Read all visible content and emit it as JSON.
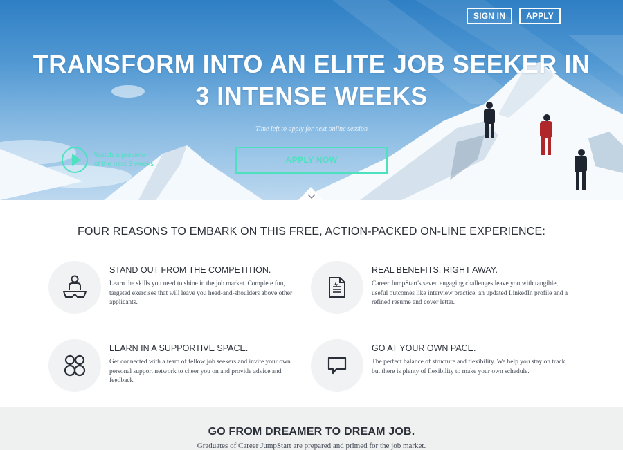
{
  "nav": {
    "sign_in": "SIGN IN",
    "apply": "APPLY"
  },
  "hero": {
    "headline_line1": "TRANSFORM INTO AN ELITE JOB SEEKER IN",
    "headline_line2": "3 INTENSE WEEKS",
    "time_left": "– Time left to apply for next online session –",
    "preview_line1": "Watch a preview",
    "preview_line2": "of the next 3 weeks",
    "apply_now": "APPLY NOW"
  },
  "reasons": {
    "title": "FOUR REASONS TO EMBARK ON THIS FREE, ACTION-PACKED ON-LINE EXPERIENCE:",
    "items": [
      {
        "icon": "meditation-person-icon",
        "heading": "STAND OUT FROM THE COMPETITION.",
        "body": "Learn the skills you need to shine in the job market. Complete fun, targeted exercises that will leave you head-and-shoulders above other applicants."
      },
      {
        "icon": "document-icon",
        "heading": "REAL BENEFITS, RIGHT AWAY.",
        "body": "Career JumpStart's seven engaging challenges leave you with tangible, useful outcomes like interview practice, an updated LinkedIn profile and a refined resume and cover letter."
      },
      {
        "icon": "group-icon",
        "heading": "LEARN IN A SUPPORTIVE SPACE.",
        "body": "Get connected with a team of fellow job seekers and invite your own personal support network to cheer you on and provide advice and feedback."
      },
      {
        "icon": "speech-bubble-icon",
        "heading": "GO AT YOUR OWN PACE.",
        "body": "The perfect balance of structure and flexibility. We help you stay on track, but there is plenty of flexibility to make your own schedule."
      }
    ]
  },
  "dream": {
    "title": "GO FROM DREAMER TO DREAM JOB.",
    "subtitle": "Graduates of Career JumpStart are prepared and primed for the job market."
  },
  "colors": {
    "accent": "#4ee1c0",
    "sky": "#4f97d2",
    "text": "#2b2f38",
    "icon_bg": "#f0f2f3"
  }
}
